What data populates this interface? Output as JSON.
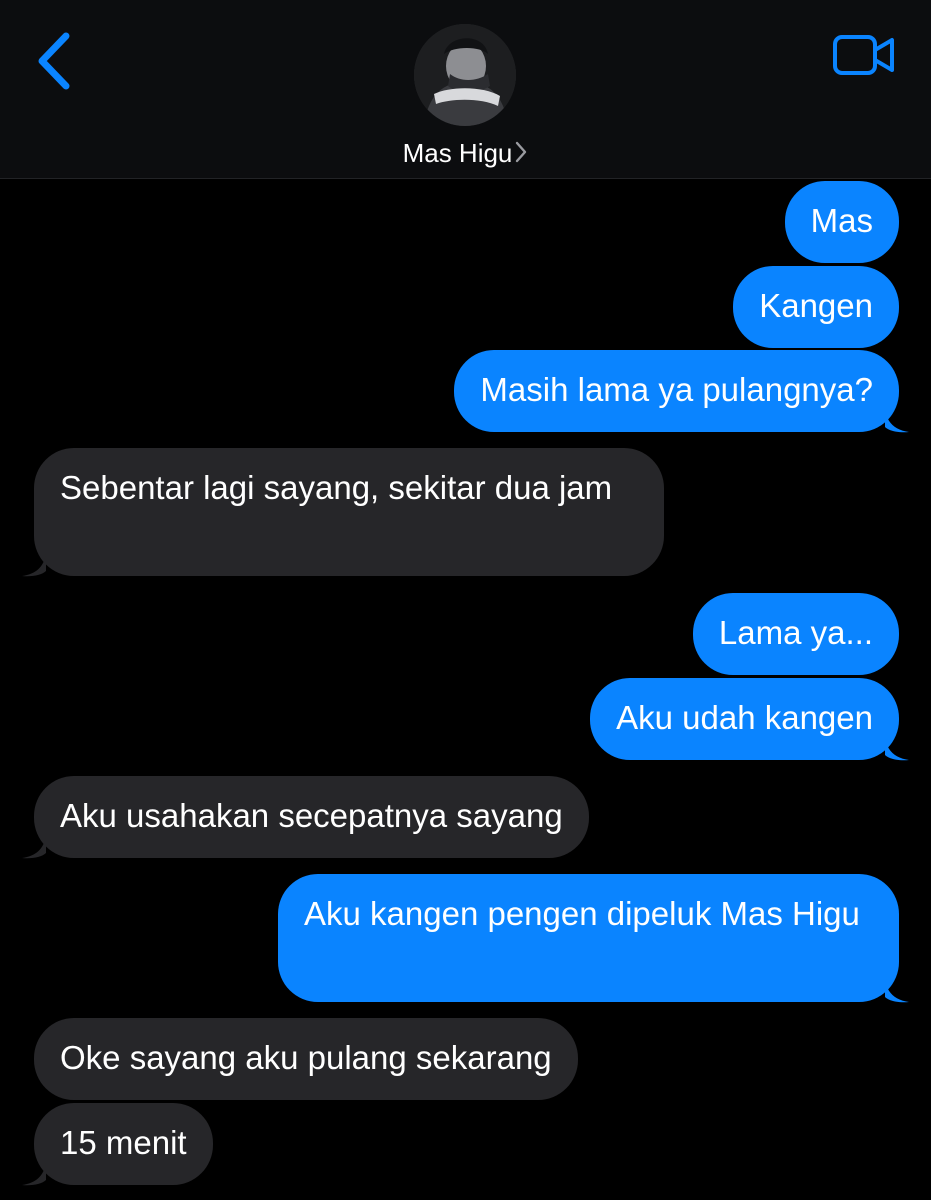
{
  "header": {
    "contact_name": "Mas Higu",
    "back_icon": "chevron-left-icon",
    "video_icon": "video-camera-icon",
    "accent_color": "#0a84ff"
  },
  "messages": [
    {
      "direction": "sent",
      "text": "Mas"
    },
    {
      "direction": "sent",
      "text": "Kangen"
    },
    {
      "direction": "sent",
      "text": "Masih lama ya pulangnya?"
    },
    {
      "direction": "received",
      "text": "Sebentar lagi sayang, sekitar dua jam"
    },
    {
      "direction": "sent",
      "text": "Lama ya..."
    },
    {
      "direction": "sent",
      "text": "Aku udah kangen"
    },
    {
      "direction": "received",
      "text": "Aku usahakan secepatnya sayang"
    },
    {
      "direction": "sent",
      "text": "Aku kangen pengen dipeluk Mas Higu"
    },
    {
      "direction": "received",
      "text": "Oke sayang aku pulang sekarang"
    },
    {
      "direction": "received",
      "text": "15 menit"
    }
  ],
  "colors": {
    "sent_bubble": "#0a84ff",
    "received_bubble": "#262629",
    "background": "#000000"
  }
}
